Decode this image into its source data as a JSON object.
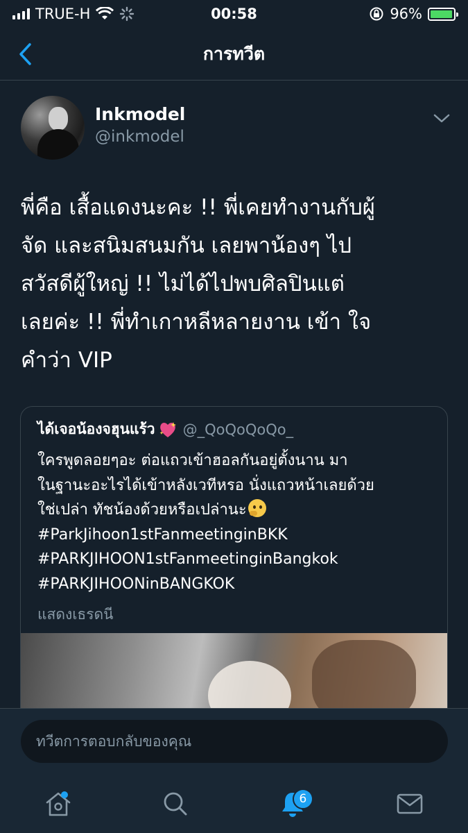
{
  "status_bar": {
    "carrier": "TRUE-H",
    "time": "00:58",
    "battery_percent": "96%",
    "battery_level": 0.96
  },
  "header": {
    "title": "การทวีต"
  },
  "tweet": {
    "author_name": "Inkmodel",
    "author_handle": "@inkmodel",
    "text": "พี่คือ เสื้อแดงนะคะ !! พี่เคยทำงานกับผู้\nจัด และสนิมสนมกัน  เลยพาน้องๆ ไป\nสวัสดีผู้ใหญ่ !! ไม่ได้ไปพบศิลปินแต่\nเลยค่ะ !!   พี่ทำเกาหลีหลายงาน เข้า ใจ\nคำว่า VIP"
  },
  "quoted_tweet": {
    "author_name": "ได้เจอน้องจฮุนแร้ว",
    "author_handle": "@_QoQoQoQo_",
    "lines": [
      "ใครพูดลอยๆอะ ต่อแถวเข้าฮอลกันอยู่ตั้งนาน มา",
      "ในฐานะอะไรได้เข้าหลังเวทีหรอ นั่งแถวหน้าเลยด้วย",
      "ใช่เปล่า ทัชน้องด้วยหรือเปล่านะ"
    ],
    "hashtags": [
      "#ParkJihoon1stFanmeetinginBKK",
      "#PARKJIHOON1stFanmeetinginBangkok",
      "#PARKJIHOONinBANGKOK"
    ],
    "show_thread": "แสดงเธรดนี"
  },
  "reply": {
    "placeholder": "ทวีตการตอบกลับของคุณ"
  },
  "tab_bar": {
    "notifications_badge": "6"
  },
  "colors": {
    "background": "#15202b",
    "accent": "#1da1f2",
    "secondary_text": "#8899a6",
    "border": "#38444d"
  }
}
